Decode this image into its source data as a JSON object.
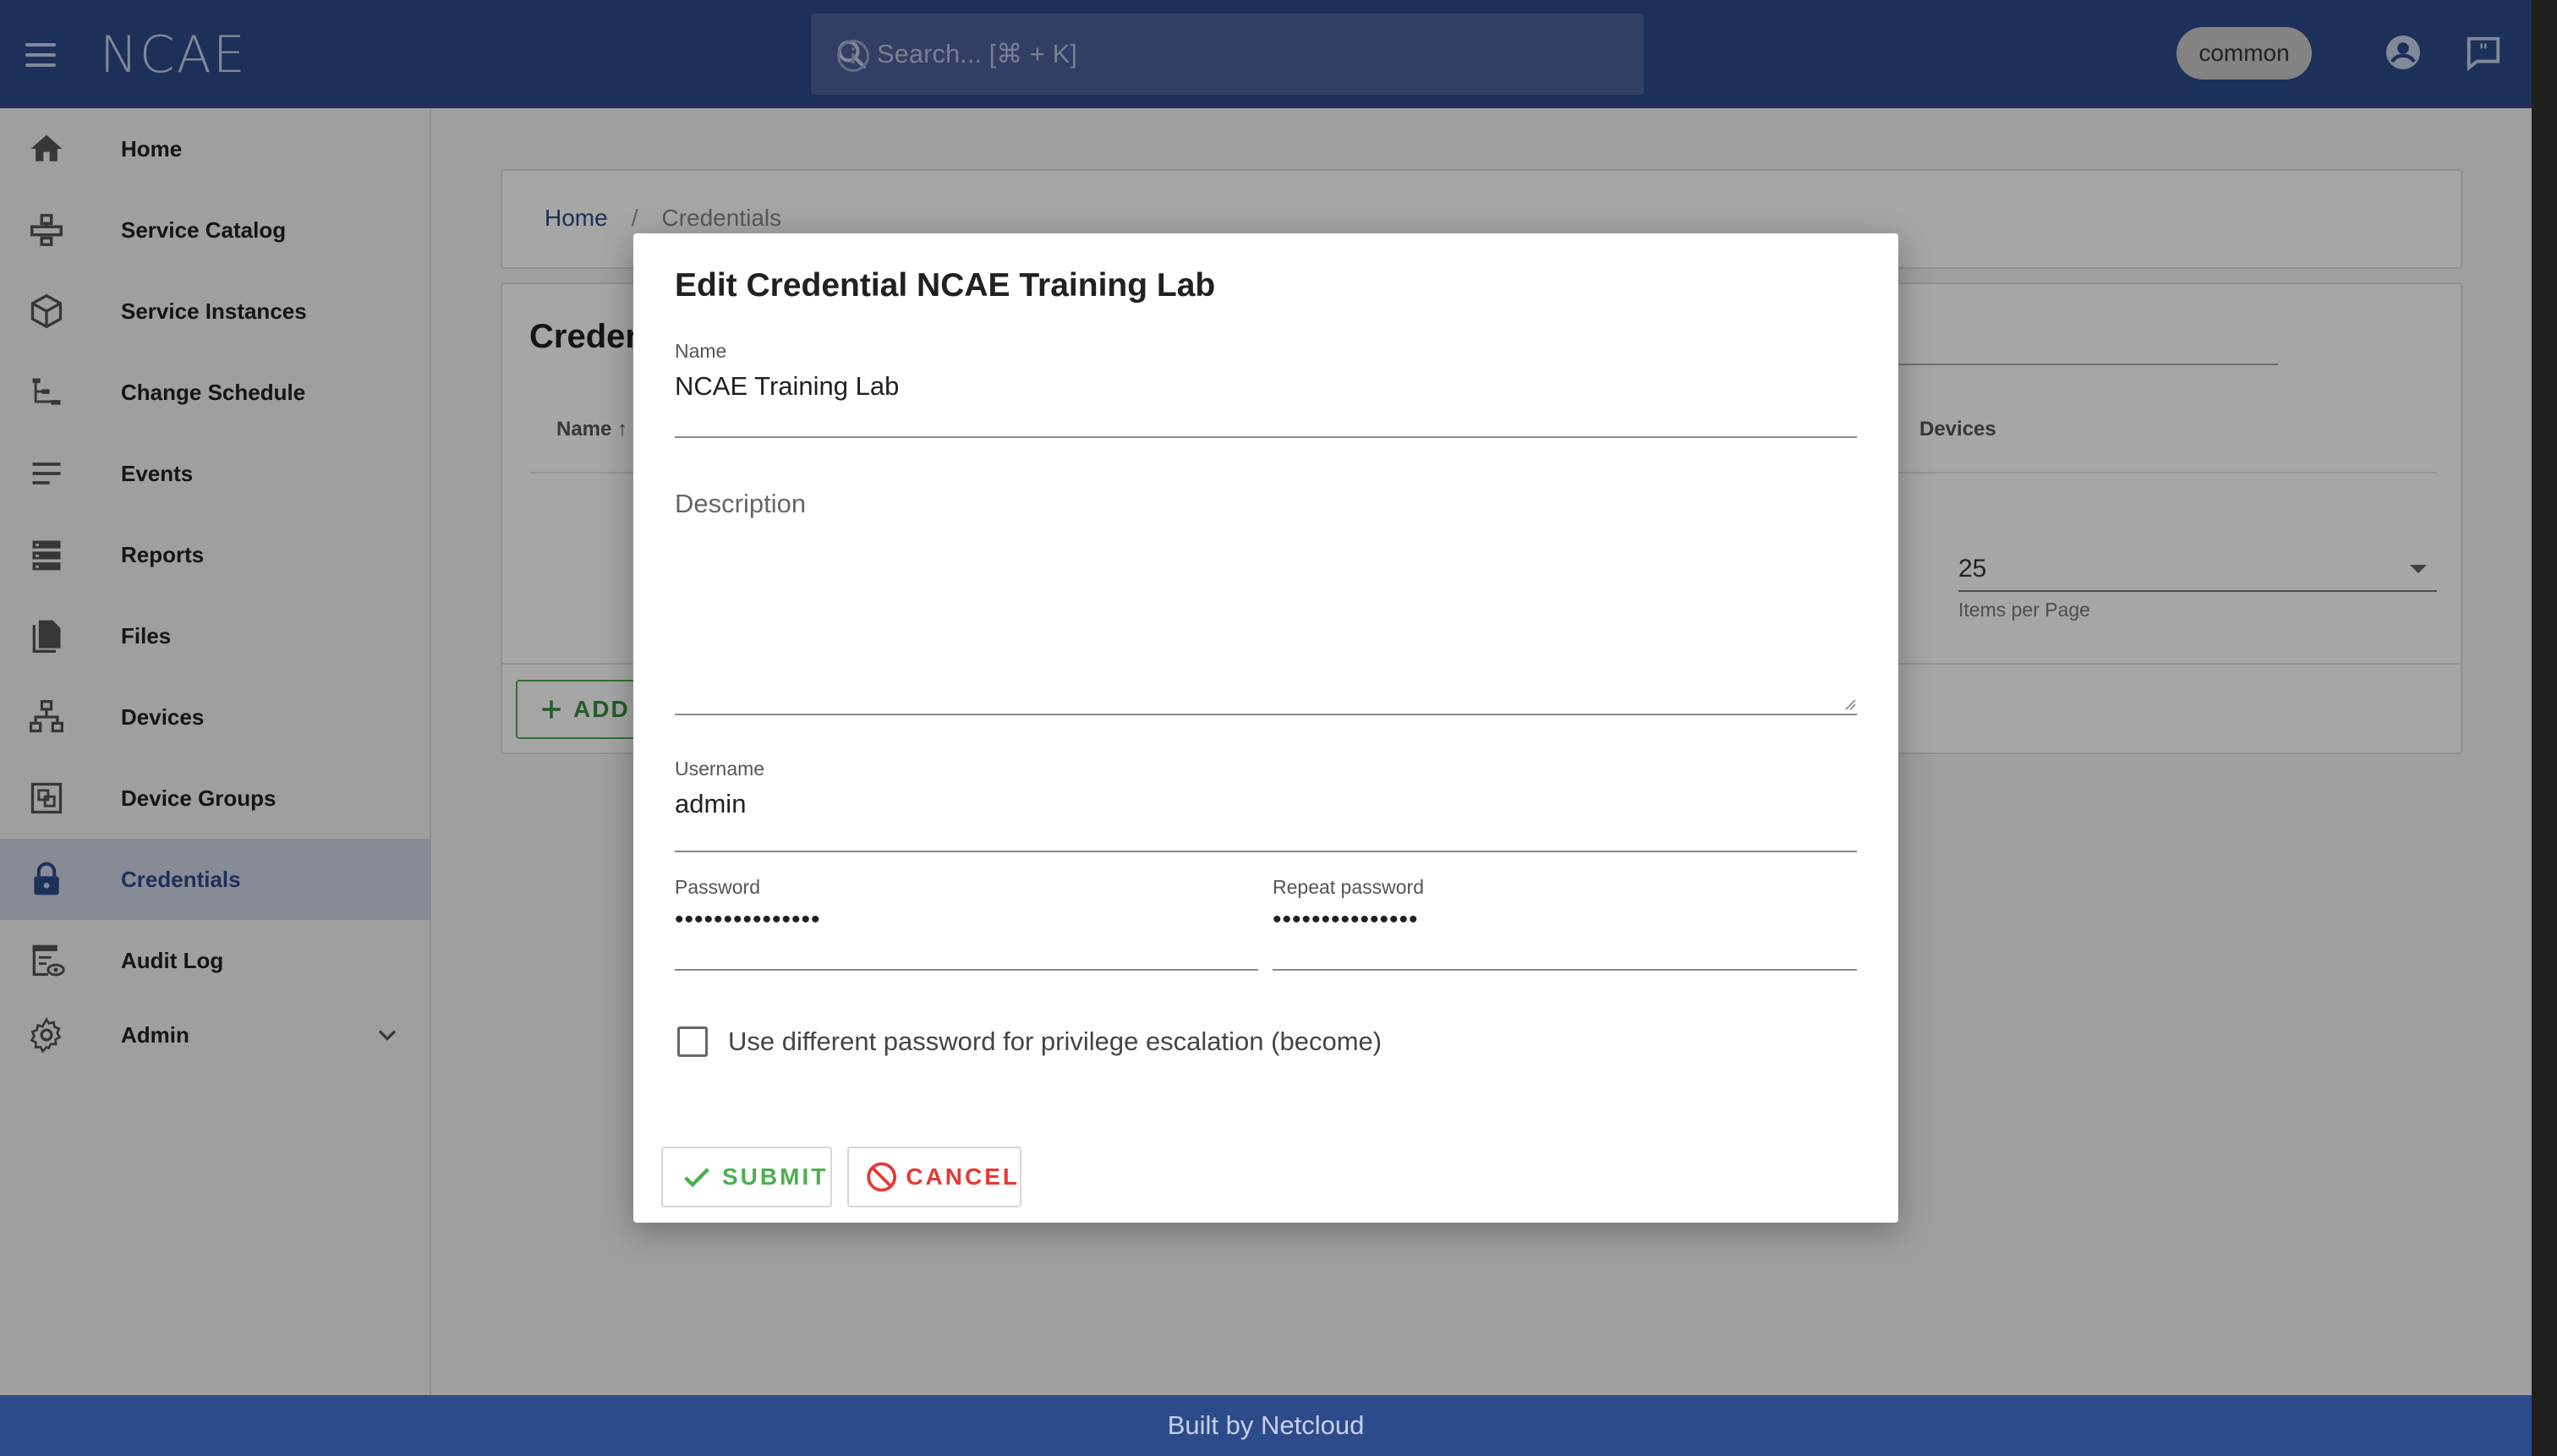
{
  "app": {
    "logo": "NCAE",
    "search_placeholder": "Search... [⌘ + K]",
    "context_chip": "common"
  },
  "sidebar": {
    "items": [
      {
        "label": "Home",
        "icon": "home-icon"
      },
      {
        "label": "Service Catalog",
        "icon": "service-catalog-icon"
      },
      {
        "label": "Service Instances",
        "icon": "cube-icon"
      },
      {
        "label": "Change Schedule",
        "icon": "schedule-icon"
      },
      {
        "label": "Events",
        "icon": "events-icon"
      },
      {
        "label": "Reports",
        "icon": "reports-icon"
      },
      {
        "label": "Files",
        "icon": "files-icon"
      },
      {
        "label": "Devices",
        "icon": "devices-icon"
      },
      {
        "label": "Device Groups",
        "icon": "device-groups-icon"
      },
      {
        "label": "Credentials",
        "icon": "lock-icon",
        "active": true
      },
      {
        "label": "Audit Log",
        "icon": "audit-log-icon"
      },
      {
        "label": "Admin",
        "icon": "gear-icon"
      }
    ]
  },
  "breadcrumb": {
    "home": "Home",
    "separator": "/",
    "current": "Credentials"
  },
  "list": {
    "title": "Creden",
    "columns": {
      "name": "Name ↑",
      "devices": "Devices"
    },
    "items_per_page_value": "25",
    "items_per_page_label": "Items per Page",
    "add_label": "ADD"
  },
  "dialog": {
    "title": "Edit Credential NCAE Training Lab",
    "name_label": "Name",
    "name_value": "NCAE Training Lab",
    "description_label": "Description",
    "username_label": "Username",
    "username_value": "admin",
    "password_label": "Password",
    "password_value": "•••••••••••••••",
    "repeat_password_label": "Repeat password",
    "repeat_password_value": "•••••••••••••••",
    "become_checkbox_label": "Use different password for privilege escalation (become)",
    "become_checked": false,
    "submit_label": "SUBMIT",
    "cancel_label": "CANCEL"
  },
  "footer": {
    "text": "Built by Netcloud"
  },
  "colors": {
    "brand": "#2d4a8a",
    "submit": "#4caf50",
    "cancel": "#e53935"
  }
}
